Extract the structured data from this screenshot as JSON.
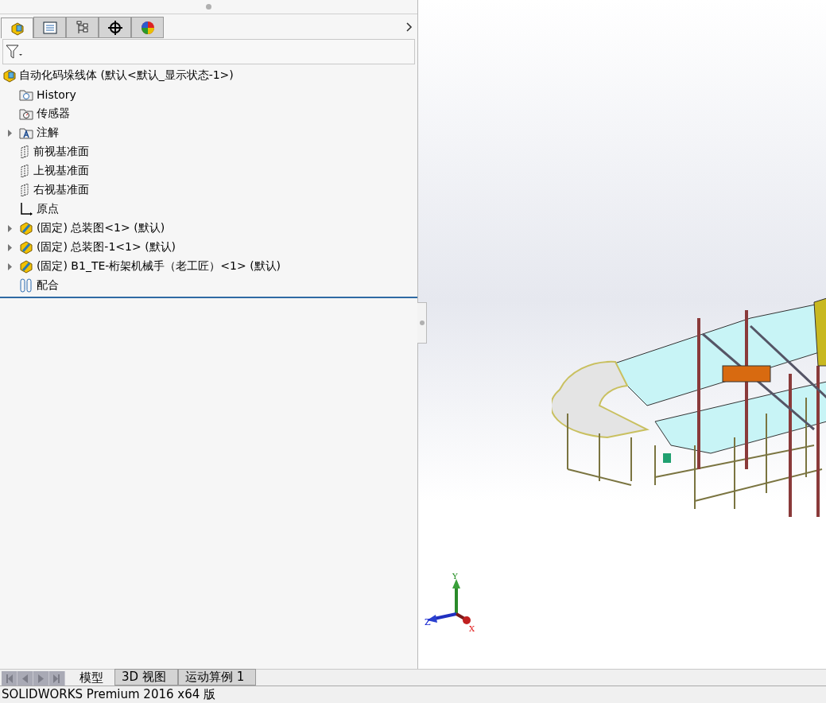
{
  "panel_tabs": [
    {
      "kind": "part",
      "selected": true
    },
    {
      "kind": "list",
      "selected": false
    },
    {
      "kind": "config",
      "selected": false
    },
    {
      "kind": "target",
      "selected": false
    },
    {
      "kind": "appearance",
      "selected": false
    }
  ],
  "tree": {
    "root": "自动化码垛线体  (默认<默认_显示状态-1>)",
    "items": [
      {
        "kind": "history",
        "label": "History",
        "expandable": false
      },
      {
        "kind": "sensor",
        "label": "传感器",
        "expandable": false
      },
      {
        "kind": "annotation",
        "label": "注解",
        "expandable": true
      },
      {
        "kind": "plane",
        "label": "前视基准面",
        "expandable": false
      },
      {
        "kind": "plane",
        "label": "上视基准面",
        "expandable": false
      },
      {
        "kind": "plane",
        "label": "右视基准面",
        "expandable": false
      },
      {
        "kind": "origin",
        "label": "原点",
        "expandable": false
      },
      {
        "kind": "assembly",
        "label": "(固定) 总装图<1> (默认)",
        "expandable": true
      },
      {
        "kind": "assembly",
        "label": "(固定) 总装图-1<1> (默认)",
        "expandable": true
      },
      {
        "kind": "assembly",
        "label": "(固定) B1_TE-桁架机械手（老工匠）<1> (默认)",
        "expandable": true
      },
      {
        "kind": "mate",
        "label": "配合",
        "expandable": false
      }
    ]
  },
  "triad": {
    "x": "X",
    "y": "Y",
    "z": "Z"
  },
  "bottom_tabs": [
    {
      "label": "模型",
      "selected": true
    },
    {
      "label": "3D 视图",
      "selected": false
    },
    {
      "label": "运动算例 1",
      "selected": false
    }
  ],
  "status_bar": "SOLIDWORKS Premium 2016 x64 版"
}
